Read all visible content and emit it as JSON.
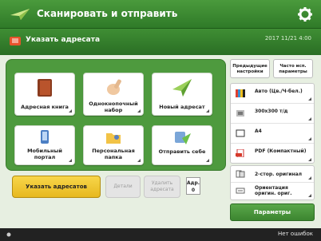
{
  "header": {
    "title": "Сканировать и отправить",
    "logo_icon": "paper-plane-icon",
    "settings_icon": "gear-icon"
  },
  "info_bar": {
    "label": "Указать адресата",
    "datetime": "2017 11/21 4:00"
  },
  "destinations": [
    {
      "label": "Адресная книга",
      "icon": "address-book-icon"
    },
    {
      "label": "Однокнопочный набор",
      "icon": "one-touch-icon"
    },
    {
      "label": "Новый адресат",
      "icon": "new-destination-icon"
    },
    {
      "label": "Мобильный портал",
      "icon": "mobile-portal-icon"
    },
    {
      "label": "Персональная папка",
      "icon": "personal-folder-icon"
    },
    {
      "label": "Отправить себе",
      "icon": "send-to-myself-icon"
    }
  ],
  "actions": {
    "register_label": "Указать адресатов",
    "details_label": "Детали",
    "delete_label": "Удалить адресата",
    "dest_count_label": "Адр.",
    "dest_count_value": "0"
  },
  "top_buttons": {
    "prev_label": "Предыдущие настройки",
    "favorites_label": "Часто исп. параметры"
  },
  "settings": [
    {
      "label": "Авто (Цв./Ч-бел.)",
      "icon": "color-mode-icon"
    },
    {
      "label": "300x300 т/д",
      "icon": "resolution-icon"
    },
    {
      "label": "A4",
      "icon": "paper-size-icon"
    },
    {
      "label": "PDF (Компактный)",
      "icon": "file-format-icon"
    }
  ],
  "settings2": [
    {
      "label": "2-стор. оригинал",
      "icon": "duplex-icon"
    },
    {
      "label": "Ориентация оригин. ориг.",
      "icon": "orientation-icon"
    }
  ],
  "params_label": "Параметры",
  "status": {
    "text": "Нет ошибок"
  },
  "colors": {
    "accent": "#3f8e34",
    "highlight": "#f0c630"
  }
}
